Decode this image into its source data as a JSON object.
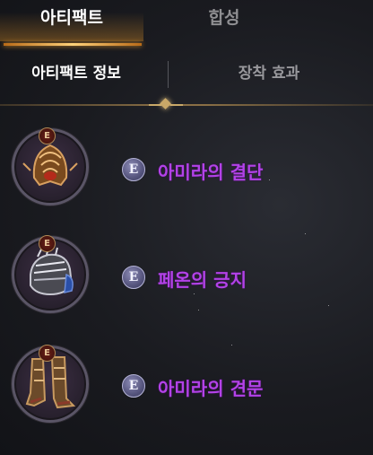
{
  "tabs": [
    {
      "label": "아티팩트",
      "active": true
    },
    {
      "label": "합성",
      "active": false
    }
  ],
  "subtabs": [
    {
      "label": "아티팩트 정보",
      "active": true
    },
    {
      "label": "장착 효과",
      "active": false
    }
  ],
  "items": [
    {
      "name": "아미라의 결단",
      "tier_badge": "E",
      "grade_badge": "E",
      "icon": "helmet-icon"
    },
    {
      "name": "페온의 긍지",
      "tier_badge": "E",
      "grade_badge": "E",
      "icon": "gauntlet-icon"
    },
    {
      "name": "아미라의 견문",
      "tier_badge": "E",
      "grade_badge": "E",
      "icon": "boots-icon"
    }
  ],
  "colors": {
    "accent_gold": "#e0952a",
    "item_name": "#b342e8",
    "grade_badge": "#56557e",
    "tier_badge": "#6a1f17"
  }
}
